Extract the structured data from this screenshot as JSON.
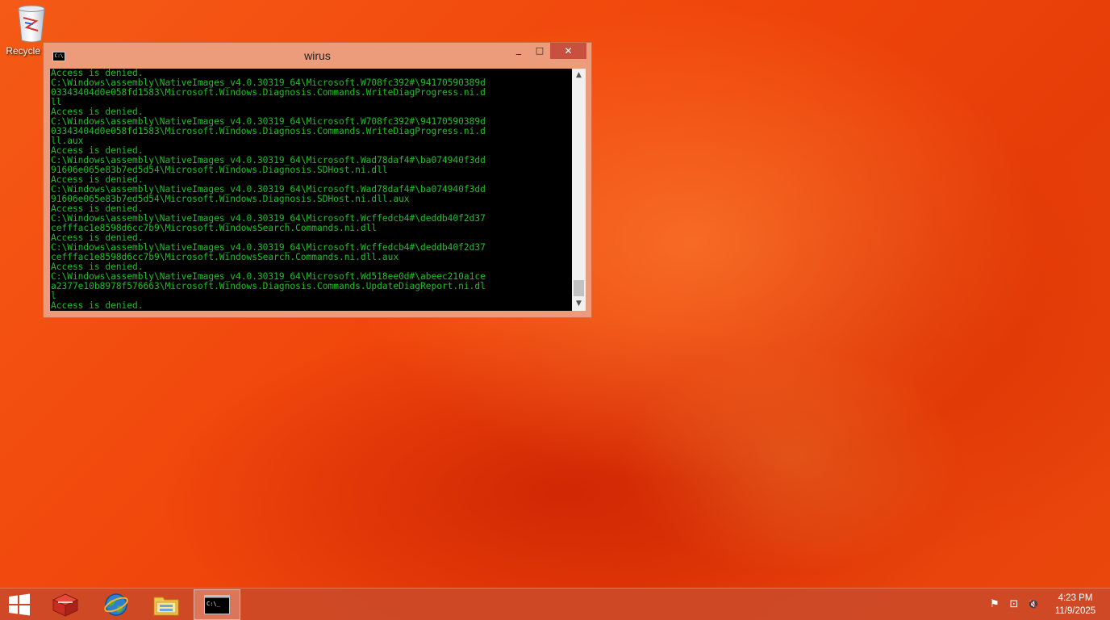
{
  "desktop": {
    "icons": [
      {
        "label": "Recycle Bin",
        "icon": "recycle-bin-icon"
      }
    ]
  },
  "window": {
    "title": "wirus",
    "icon": "console-icon",
    "controls": {
      "minimize": "_",
      "maximize": "□",
      "close": "✕"
    }
  },
  "console": {
    "text_color": "#1fbf2b",
    "background_color": "#000000",
    "lines": [
      "Access is denied.",
      "C:\\Windows\\assembly\\NativeImages_v4.0.30319_64\\Microsoft.W708fc392#\\9417059038​9d",
      "03343404d0e058fd1583\\Microsoft.Windows.Diagnosis.Commands.WriteDiagProgress.ni.d",
      "ll",
      "Access is denied.",
      "C:\\Windows\\assembly\\NativeImages_v4.0.30319_64\\Microsoft.W708fc392#\\94170590389d",
      "03343404d0e058fd1583\\Microsoft.Windows.Diagnosis.Commands.WriteDiagProgress.ni.d",
      "ll.aux",
      "Access is denied.",
      "C:\\Windows\\assembly\\NativeImages_v4.0.30319_64\\Microsoft.Wad78daf4#\\ba074940f3dd",
      "91606e065e83b7ed5d54\\Microsoft.Windows.Diagnosis.SDHost.ni.dll",
      "Access is denied.",
      "C:\\Windows\\assembly\\NativeImages_v4.0.30319_64\\Microsoft.Wad78daf4#\\ba074940f3dd",
      "91606e065e83b7ed5d54\\Microsoft.Windows.Diagnosis.SDHost.ni.dll.aux",
      "Access is denied.",
      "C:\\Windows\\assembly\\NativeImages_v4.0.30319_64\\Microsoft.Wcffedcb4#\\deddb40f2d37",
      "cefffac1e8598d6cc7b9\\Microsoft.WindowsSearch.Commands.ni.dll",
      "Access is denied.",
      "C:\\Windows\\assembly\\NativeImages_v4.0.30319_64\\Microsoft.Wcffedcb4#\\deddb40f2d37",
      "cefffac1e8598d6cc7b9\\Microsoft.WindowsSearch.Commands.ni.dll.aux",
      "Access is denied.",
      "C:\\Windows\\assembly\\NativeImages_v4.0.30319_64\\Microsoft.Wd518ee0d#\\abeec210a1ce",
      "a2377e10b8978f576663\\Microsoft.Windows.Diagnosis.Commands.UpdateDiagReport.ni.dl",
      "l",
      "Access is denied."
    ]
  },
  "taskbar": {
    "start": {
      "icon": "windows-start-icon"
    },
    "pinned": [
      {
        "icon": "red-box-app-icon",
        "active": false
      },
      {
        "icon": "globe-browser-icon",
        "active": false
      },
      {
        "icon": "file-explorer-icon",
        "active": false
      },
      {
        "icon": "command-prompt-icon",
        "active": true,
        "glyph": "C:\\_"
      }
    ],
    "tray": [
      {
        "icon": "action-center-flag-icon",
        "glyph": "⚑"
      },
      {
        "icon": "network-icon",
        "glyph": "⊡"
      },
      {
        "icon": "volume-muted-icon",
        "glyph": "🔇"
      }
    ],
    "clock": {
      "time": "4:23 PM",
      "date": "11/9/2025"
    }
  }
}
